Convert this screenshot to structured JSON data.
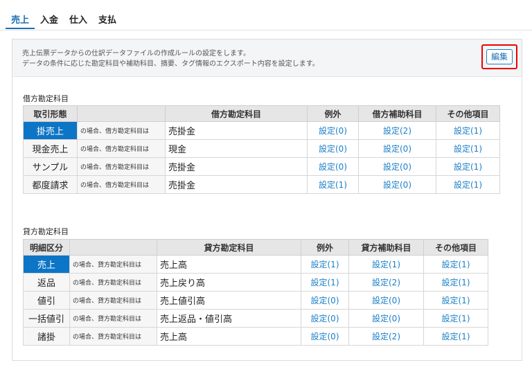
{
  "tabs": [
    "売上",
    "入金",
    "仕入",
    "支払"
  ],
  "active_tab": 0,
  "header": {
    "desc_line1": "売上伝票データからの仕訳データファイルの作成ルールの設定をします。",
    "desc_line2": "データの条件に応じた勘定科目や補助科目、摘要、タグ情報のエクスポート内容を設定します。",
    "edit_label": "編集"
  },
  "debit": {
    "title": "借方勘定科目",
    "headers": [
      "取引形態",
      "",
      "借方勘定科目",
      "例外",
      "借方補助科目",
      "その他項目"
    ],
    "cond_text": "の場合、借方勘定科目は",
    "rows": [
      {
        "type": "掛売上",
        "account": "売掛金",
        "exception": "設定(0)",
        "sub": "設定(2)",
        "other": "設定(1)",
        "active": true
      },
      {
        "type": "現金売上",
        "account": "現金",
        "exception": "設定(0)",
        "sub": "設定(0)",
        "other": "設定(1)",
        "active": false
      },
      {
        "type": "サンプル",
        "account": "売掛金",
        "exception": "設定(0)",
        "sub": "設定(0)",
        "other": "設定(1)",
        "active": false
      },
      {
        "type": "都度請求",
        "account": "売掛金",
        "exception": "設定(1)",
        "sub": "設定(0)",
        "other": "設定(1)",
        "active": false
      }
    ]
  },
  "credit": {
    "title": "貸方勘定科目",
    "headers": [
      "明細区分",
      "",
      "貸方勘定科目",
      "例外",
      "貸方補助科目",
      "その他項目"
    ],
    "cond_text": "の場合、貸方勘定科目は",
    "rows": [
      {
        "type": "売上",
        "account": "売上高",
        "exception": "設定(1)",
        "sub": "設定(1)",
        "other": "設定(1)",
        "active": true
      },
      {
        "type": "返品",
        "account": "売上戻り高",
        "exception": "設定(1)",
        "sub": "設定(2)",
        "other": "設定(1)",
        "active": false
      },
      {
        "type": "値引",
        "account": "売上値引高",
        "exception": "設定(0)",
        "sub": "設定(0)",
        "other": "設定(1)",
        "active": false
      },
      {
        "type": "一括値引",
        "account": "売上返品・値引高",
        "exception": "設定(0)",
        "sub": "設定(0)",
        "other": "設定(1)",
        "active": false
      },
      {
        "type": "諸掛",
        "account": "売上高",
        "exception": "設定(0)",
        "sub": "設定(2)",
        "other": "設定(1)",
        "active": false
      }
    ]
  }
}
